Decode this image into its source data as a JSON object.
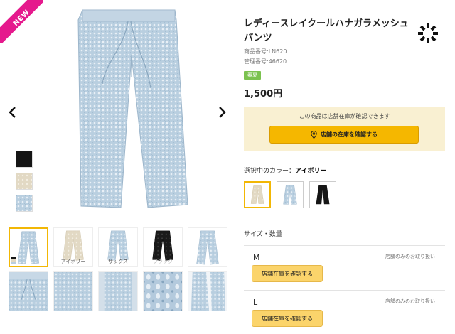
{
  "badge_new": "NEW",
  "product": {
    "title": "レディースレイクールハナガラメッシュパンツ",
    "product_no": "商品番号:LN620",
    "manage_no": "管理番号:46620",
    "tag": "春夏",
    "price": "1,500円"
  },
  "stock": {
    "message": "この商品は店舗在庫が確認できます",
    "button_label": "店舗の在庫を確認する"
  },
  "colors": {
    "label": "選択中のカラー：",
    "selected": "アイボリー",
    "options": [
      "ivory",
      "sax",
      "black"
    ]
  },
  "thumbnails": {
    "row1_captions": [
      "",
      "アイボリー",
      "サックス",
      "ブラック",
      ""
    ]
  },
  "sizes": {
    "heading": "サイズ・数量",
    "items": [
      {
        "label": "M",
        "note": "店舗のみのお取り扱い",
        "button": "店舗在庫を確認する"
      },
      {
        "label": "L",
        "note": "店舗のみのお取り扱い",
        "button": "店舗在庫を確認する"
      }
    ]
  },
  "palette": {
    "accent": "#f5b700",
    "new_badge": "#e5198d",
    "season_tag": "#7bc24f",
    "stock_bg": "#f9f0d2"
  },
  "icons": [
    "chevron-left-icon",
    "chevron-right-icon",
    "location-pin-icon",
    "brand-logo-icon"
  ]
}
